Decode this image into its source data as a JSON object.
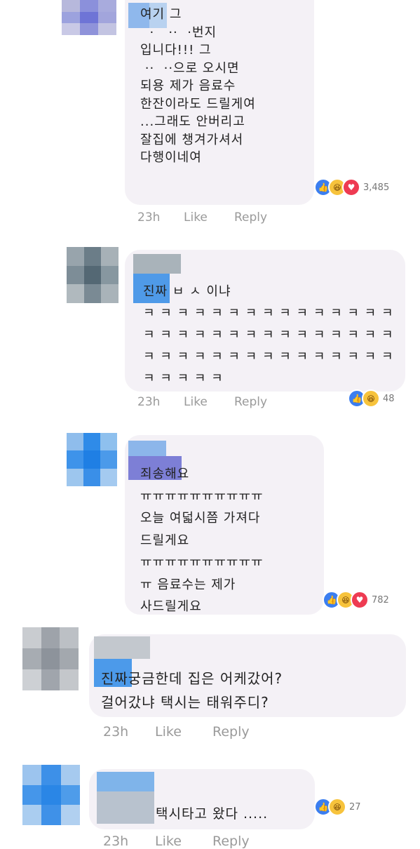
{
  "comments": [
    {
      "text": "여기 그\n  ·   ··  ·번지\n입니다!!! 그\n ··  ··으로 오시면\n되용 제가 음료수\n한잔이라도 드릴게여\n...그래도 안버리고\n잘집에 챙겨가셔서\n다행이네여",
      "reactions": [
        "like",
        "haha",
        "love"
      ],
      "count": "3,485",
      "time": "23h",
      "like": "Like",
      "reply": "Reply"
    },
    {
      "text": "진짜 ㅂ ㅅ 이냐\nㅋ ㅋ ㅋ ㅋ ㅋ ㅋ ㅋ ㅋ ㅋ ㅋ ㅋ ㅋ ㅋ ㅋ ㅋ\nㅋ ㅋ ㅋ ㅋ ㅋ ㅋ ㅋ ㅋ ㅋ ㅋ ㅋ ㅋ ㅋ ㅋ ㅋ\nㅋ ㅋ ㅋ ㅋ ㅋ ㅋ ㅋ ㅋ ㅋ ㅋ ㅋ ㅋ ㅋ ㅋ ㅋ\nㅋ ㅋ ㅋ ㅋ ㅋ",
      "reactions": [
        "like",
        "haha"
      ],
      "count": "48",
      "time": "23h",
      "like": "Like",
      "reply": "Reply"
    },
    {
      "text": "죄송해요\nㅠㅠㅠㅠㅠㅠㅠㅠㅠㅠ\n오늘 여덟시쯤 가져다\n드릴게요\nㅠㅠㅠㅠㅠㅠㅠㅠㅠㅠ\nㅠ 음료수는 제가\n사드릴게요",
      "reactions": [
        "like",
        "haha",
        "love"
      ],
      "count": "782",
      "time": "",
      "like": "",
      "reply": ""
    },
    {
      "text": "진짜궁금한데 집은 어케갔어?\n걸어갔냐 택시는 태워주디?",
      "reactions": [],
      "count": "",
      "time": "23h",
      "like": "Like",
      "reply": "Reply"
    },
    {
      "text": "택시타고 왔다 .....",
      "reactions": [
        "like",
        "haha"
      ],
      "count": "27",
      "time": "23h",
      "like": "Like",
      "reply": "Reply"
    }
  ],
  "colors": {
    "bubble": "#f4f1f6",
    "meta": "#9a9a9a",
    "like": "#3b7ef0",
    "haha": "#f7c33c",
    "love": "#ee3b52"
  }
}
